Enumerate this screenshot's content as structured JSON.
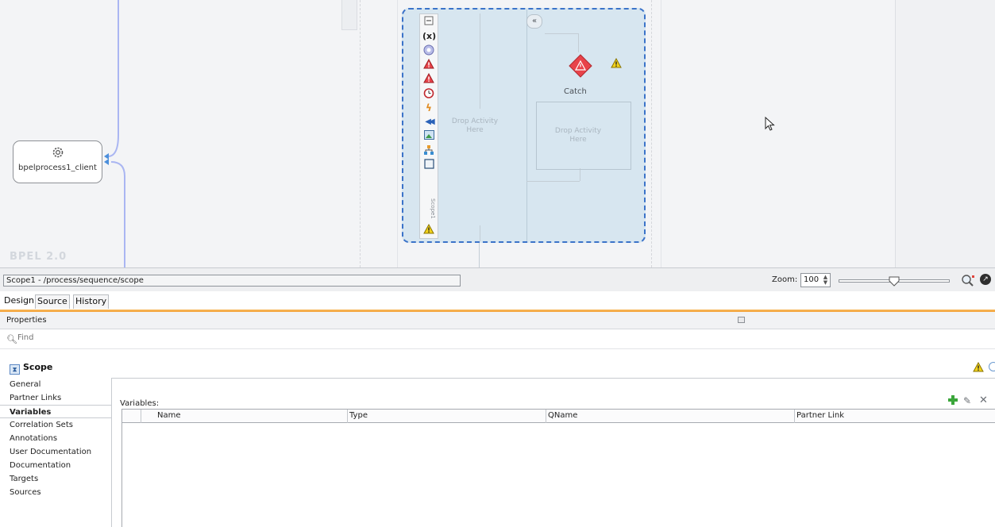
{
  "canvas": {
    "version_label": "BPEL 2.0",
    "client_node_label": "bpelprocess1_client",
    "scope_toolbar_label": "Scope1",
    "drop_left": "Drop Activity Here",
    "drop_right": "Drop Activity Here",
    "catch_label": "Catch",
    "icons": [
      "collapse-icon",
      "variable-icon",
      "correlation-icon",
      "fault-icon",
      "catch-all-icon",
      "timer-icon",
      "event-icon",
      "compensation-icon",
      "image-icon",
      "tree-icon",
      "document-icon",
      "warning-icon"
    ]
  },
  "pathbar": {
    "path": "Scope1 - /process/sequence/scope",
    "zoom_label": "Zoom:",
    "zoom_value": "100",
    "zoom_level": 0.5
  },
  "tabs": [
    "Design",
    "Source",
    "History"
  ],
  "properties": {
    "title": "Properties",
    "find_placeholder": "Find",
    "heading": "Scope",
    "nav": [
      "General",
      "Partner Links",
      "Variables",
      "Correlation Sets",
      "Annotations",
      "User Documentation",
      "Documentation",
      "Targets",
      "Sources"
    ],
    "selected_nav": "Variables",
    "variables_label": "Variables:",
    "columns": [
      "Name",
      "Type",
      "QName",
      "Partner Link"
    ]
  },
  "colors": {
    "accent_orange": "#f3a23a",
    "scope_border": "#3b73c9",
    "scope_fill": "#d7e6f0",
    "catch_red": "#e8434a",
    "add_green": "#3ba63b"
  }
}
